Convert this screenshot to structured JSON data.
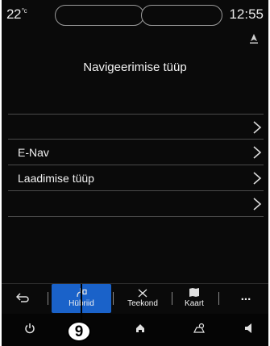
{
  "status_bar": {
    "temperature": "22",
    "temperature_unit": "°c",
    "time": "12:55"
  },
  "screen": {
    "title": "Navigeerimise tüüp"
  },
  "menu_rows": [
    {
      "label": ""
    },
    {
      "label": "E-Nav"
    },
    {
      "label": "Laadimise tüüp"
    },
    {
      "label": ""
    }
  ],
  "tabs": {
    "hybrid_label": "Hübriid",
    "route_label": "Teekond",
    "map_label": "Kaart",
    "more_label": "..."
  },
  "callout": {
    "number": "9"
  },
  "colors": {
    "background": "#0a0a0a",
    "active_tab": "#1a62c9",
    "text": "#f2f2f2"
  }
}
